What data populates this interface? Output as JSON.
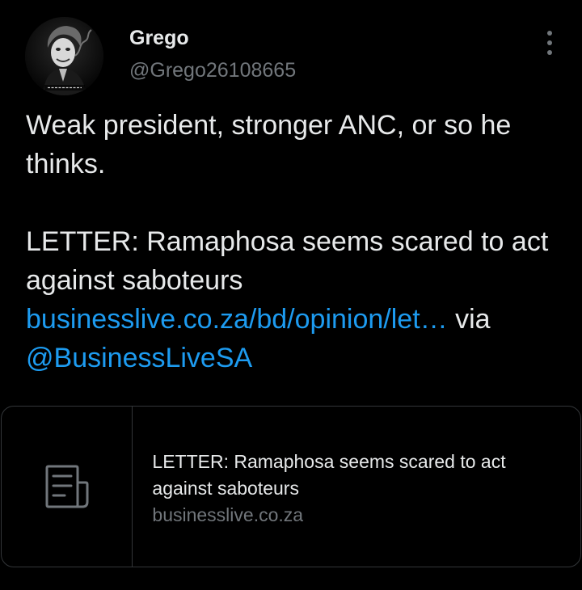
{
  "author": {
    "display_name": "Grego",
    "handle": "@Grego26108665",
    "avatar_icon": "joker-avatar"
  },
  "tweet": {
    "line1": "Weak president, stronger ANC, or so he thinks.",
    "line2": "LETTER: Ramaphosa seems scared to act against saboteurs",
    "link_text": "businesslive.co.za/bd/opinion/let…",
    "via_text": " via ",
    "mention": "@BusinessLiveSA"
  },
  "card": {
    "icon": "article-icon",
    "title": "LETTER: Ramaphosa seems scared to act against saboteurs",
    "domain": "businesslive.co.za"
  },
  "colors": {
    "background": "#000000",
    "text": "#e7e9ea",
    "secondary": "#71767b",
    "link": "#1d9bf0",
    "border": "#333639"
  }
}
